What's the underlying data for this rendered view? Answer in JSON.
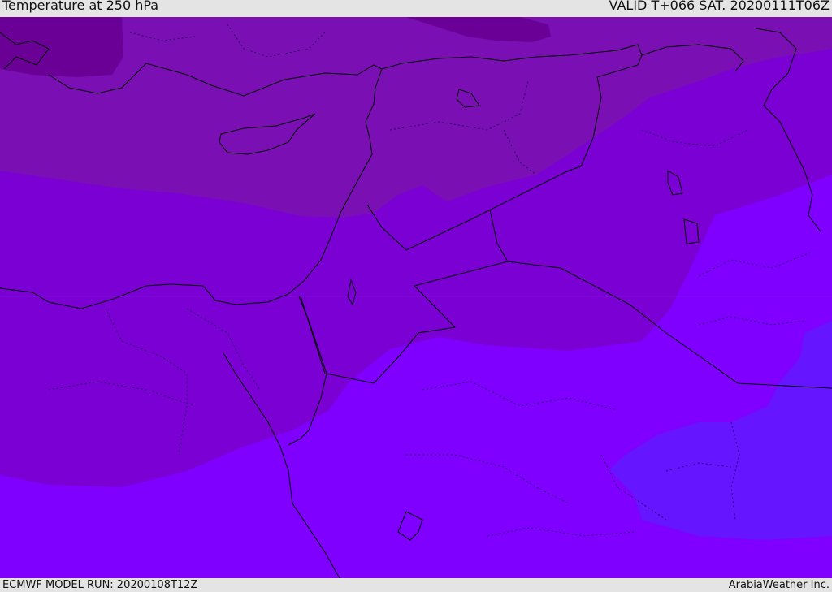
{
  "header": {
    "title": "Temperature at 250 hPa",
    "valid_time": "VALID T+066 SAT. 20200111T06Z"
  },
  "footer": {
    "model_run": "ECMWF MODEL RUN: 20200108T12Z",
    "credit": "ArabiaWeather Inc."
  },
  "map": {
    "colors": {
      "coldest": "#6a0096",
      "colder": "#7a10b4",
      "cold": "#7a00d4",
      "mild": "#7f00ff",
      "warm": "#6515ff",
      "coast_line": "#000000",
      "border_line": "#000000",
      "region_line": "#2a0060"
    }
  }
}
